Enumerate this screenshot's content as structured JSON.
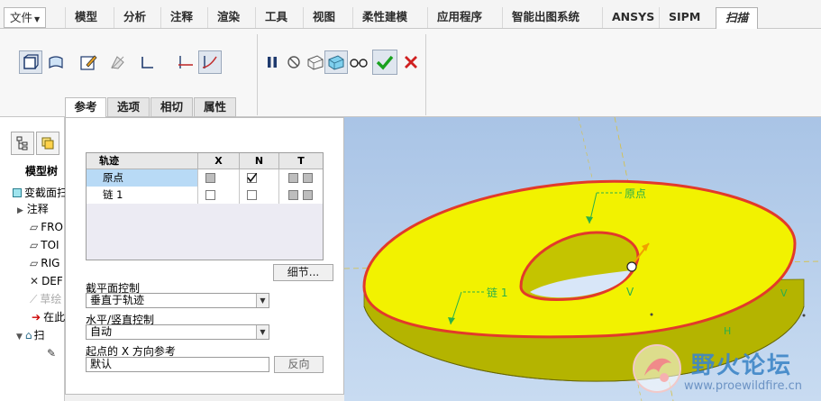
{
  "menu": {
    "file": "文件",
    "tabs": [
      "模型",
      "分析",
      "注释",
      "渲染",
      "工具",
      "视图",
      "柔性建模",
      "应用程序",
      "智能出图系统",
      "ANSYS",
      "SIPM"
    ],
    "active_tab": "扫描"
  },
  "dashboard": {
    "tabs": [
      "参考",
      "选项",
      "相切",
      "属性"
    ]
  },
  "left_panel": {
    "header": "模型树",
    "items": [
      "变截面扫",
      "注释",
      "FRO",
      "TOI",
      "RIG",
      "DEF",
      "草绘",
      "在此",
      "扫"
    ]
  },
  "references": {
    "table": {
      "headers": [
        "轨迹",
        "X",
        "N",
        "T"
      ],
      "rows": [
        {
          "name": "原点",
          "x": "gray",
          "n": "checked",
          "t": "boxes"
        },
        {
          "name": "链 1",
          "x": "empty",
          "n": "empty",
          "t": "boxes"
        }
      ]
    },
    "details_button": "细节...",
    "section_plane_control": {
      "label": "截平面控制",
      "value": "垂直于轨迹"
    },
    "hv_control": {
      "label": "水平/竖直控制",
      "value": "自动"
    },
    "x_direction": {
      "label": "起点的 X 方向参考",
      "value": "默认",
      "flip_button": "反向"
    }
  },
  "viewport": {
    "labels": {
      "origin": "原点",
      "chain": "链 1",
      "v_left": "V",
      "v_right": "V",
      "h": "H"
    },
    "colors": {
      "surface": "#f2f200",
      "edge": "#e23a2a",
      "background": "#b8d0ee",
      "side": "#bcbc00"
    }
  },
  "watermark": {
    "title": "野火论坛",
    "url": "www.proewildfire.cn"
  }
}
